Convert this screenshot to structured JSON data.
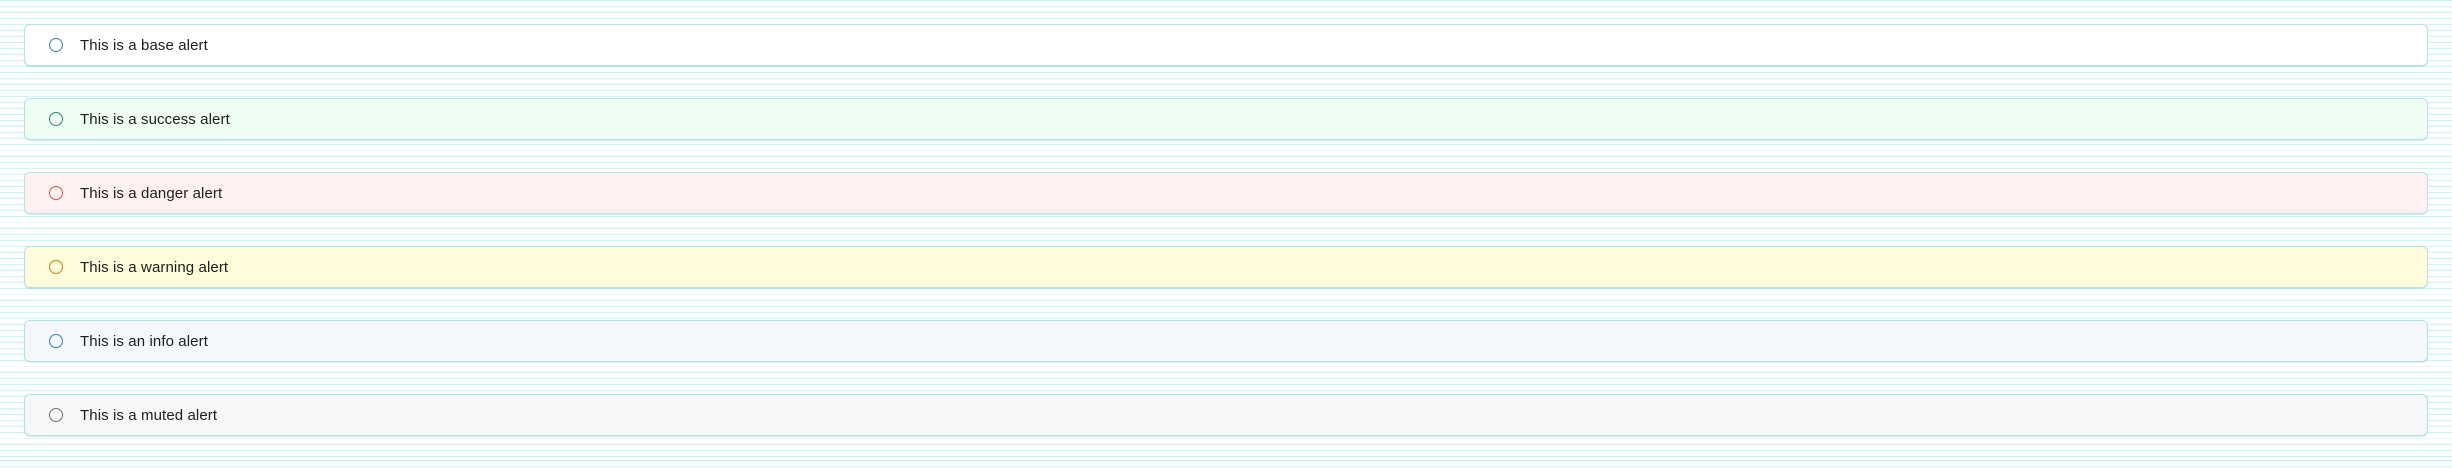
{
  "alerts": [
    {
      "text": "This is a base alert",
      "variant": "base",
      "background": "#ffffff",
      "icon_color": "#2f7fd1",
      "icon": "circle-outline-icon"
    },
    {
      "text": "This is a success alert",
      "variant": "success",
      "background": "#effdf4",
      "icon_color": "#2a8a5e",
      "icon": "circle-outline-icon"
    },
    {
      "text": "This is a danger alert",
      "variant": "danger",
      "background": "#fff1f1",
      "icon_color": "#d9534f",
      "icon": "circle-outline-icon"
    },
    {
      "text": "This is a warning alert",
      "variant": "warning",
      "background": "#fffbdb",
      "icon_color": "#c9850f",
      "icon": "circle-outline-icon"
    },
    {
      "text": "This is an info alert",
      "variant": "info",
      "background": "#f4f8fc",
      "icon_color": "#2f7fd1",
      "icon": "circle-outline-icon"
    },
    {
      "text": "This is a muted alert",
      "variant": "muted",
      "background": "#f6f7f8",
      "icon_color": "#707070",
      "icon": "circle-outline-icon"
    }
  ]
}
